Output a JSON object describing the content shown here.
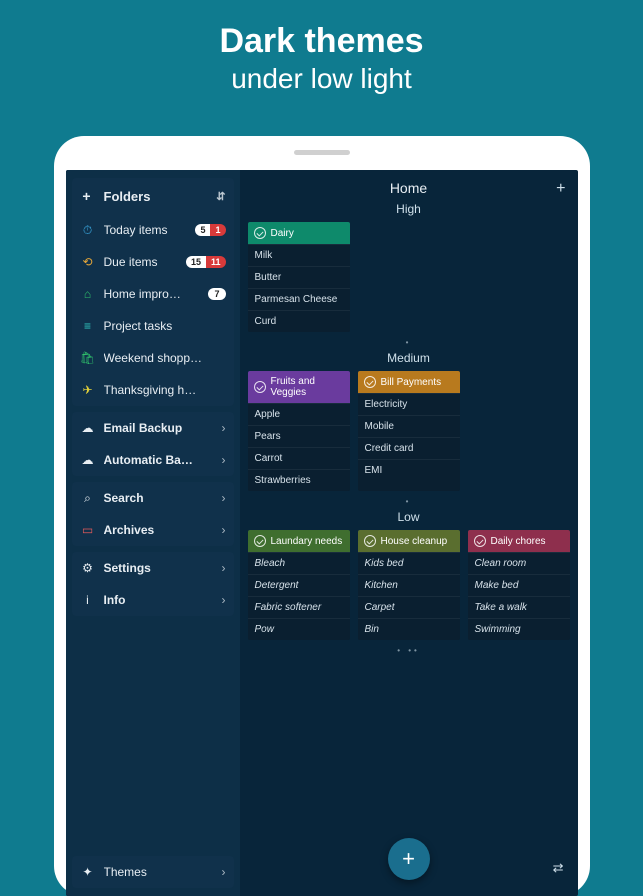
{
  "promo": {
    "line1": "Dark themes",
    "line2": "under low light"
  },
  "sidebar": {
    "folders_header": {
      "add": "+",
      "label": "Folders",
      "sort": "⇵"
    },
    "folders": [
      {
        "icon": "⏱",
        "ic_class": "ic-blue",
        "label": "Today items",
        "badge": {
          "a": "5",
          "b": "1"
        }
      },
      {
        "icon": "⟲",
        "ic_class": "ic-orange",
        "label": "Due items",
        "badge": {
          "a": "15",
          "b": "11"
        }
      },
      {
        "icon": "⌂",
        "ic_class": "ic-green",
        "label": "Home impro…",
        "pill": "7"
      },
      {
        "icon": "≡",
        "ic_class": "ic-teal",
        "label": "Project tasks"
      },
      {
        "icon": "🛍",
        "ic_class": "ic-green",
        "label": "Weekend shopp…"
      },
      {
        "icon": "✈",
        "ic_class": "ic-yellow",
        "label": "Thanksgiving h…"
      }
    ],
    "backup": [
      {
        "icon": "☁",
        "label": "Email Backup"
      },
      {
        "icon": "☁",
        "label": "Automatic Ba…"
      }
    ],
    "tools": [
      {
        "icon": "⌕",
        "label": "Search"
      },
      {
        "icon": "▭",
        "ic_class": "ic-red",
        "label": "Archives"
      }
    ],
    "settings": [
      {
        "icon": "⚙",
        "label": "Settings"
      },
      {
        "icon": "i",
        "label": "Info"
      }
    ],
    "themes": {
      "icon": "✦",
      "label": "Themes"
    }
  },
  "main": {
    "title": "Home",
    "add": "+",
    "sections": [
      {
        "label": "High",
        "cards": [
          {
            "title": "Dairy",
            "color": "#0e8a6b",
            "items": [
              "Milk",
              "Butter",
              "Parmesan Cheese",
              "Curd"
            ]
          }
        ]
      },
      {
        "label": "Medium",
        "cards": [
          {
            "title": "Fruits and Veggies",
            "color": "#6a3b9e",
            "items": [
              "Apple",
              "Pears",
              "Carrot",
              "Strawberries"
            ]
          },
          {
            "title": "Bill Payments",
            "color": "#b87a1e",
            "items": [
              "Electricity",
              "Mobile",
              "Credit card",
              "EMI"
            ]
          }
        ]
      },
      {
        "label": "Low",
        "cards": [
          {
            "title": "Laundary needs",
            "color": "#3f6e2f",
            "italic": true,
            "items": [
              "Bleach",
              "Detergent",
              "Fabric softener",
              "Pow"
            ]
          },
          {
            "title": "House cleanup",
            "color": "#5a6e2f",
            "italic": true,
            "items": [
              "Kids bed",
              "Kitchen",
              "Carpet",
              "Bin"
            ]
          },
          {
            "title": "Daily chores",
            "color": "#8e2f4d",
            "italic": true,
            "items": [
              "Clean room",
              "Make bed",
              "Take a walk",
              "Swimming"
            ]
          }
        ]
      }
    ],
    "fab": "+",
    "swap": "⇄"
  }
}
